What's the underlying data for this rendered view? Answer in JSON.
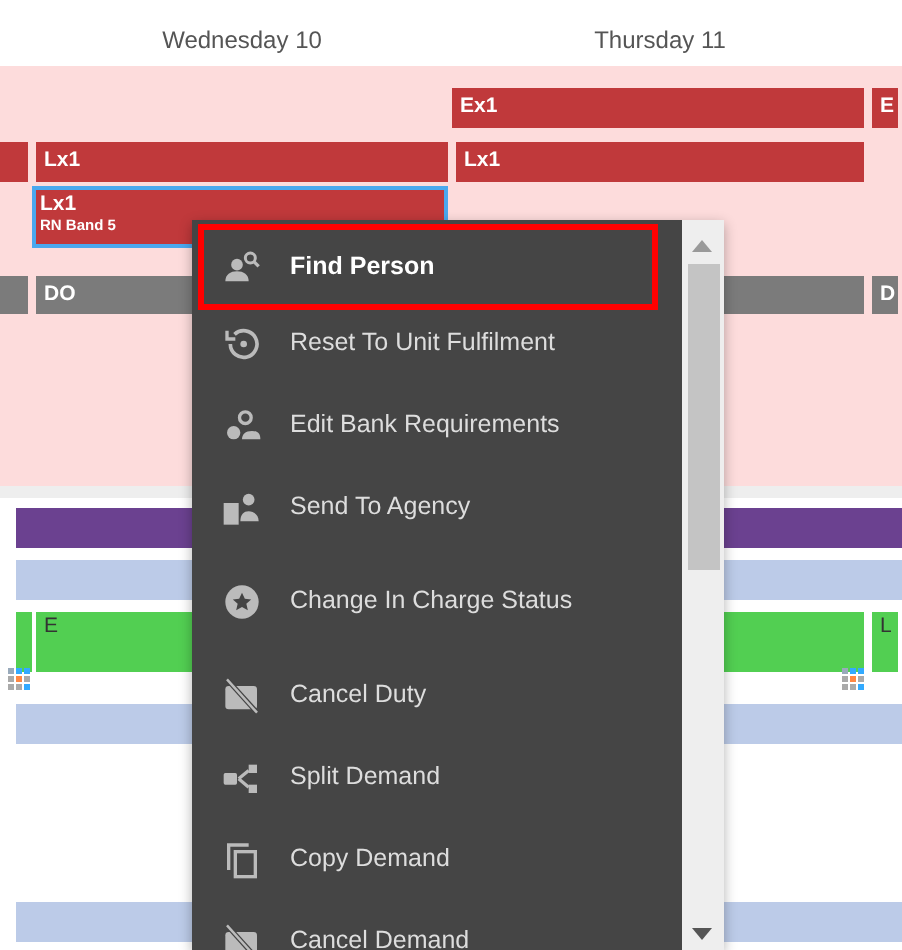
{
  "day_headers": [
    "Wednesday 10",
    "Thursday 11"
  ],
  "upper_lanes": [
    {
      "kind": "short",
      "cells": [
        {
          "kind": "empty"
        },
        {
          "kind": "empty"
        },
        {
          "kind": "bar",
          "label": "Ex1",
          "color": "#c0393b",
          "selected": false
        },
        {
          "kind": "bar",
          "label": "E",
          "color": "#c0393b",
          "selected": false
        }
      ]
    },
    {
      "kind": "short",
      "cells": [
        {
          "kind": "bar",
          "color": "#c0393b",
          "selected": false
        },
        {
          "kind": "bar",
          "label": "Lx1",
          "color": "#c0393b",
          "selected": false
        },
        {
          "kind": "bar",
          "label": "Lx1",
          "color": "#c0393b",
          "selected": false
        },
        {
          "kind": "empty"
        }
      ]
    },
    {
      "kind": "tall",
      "cells": [
        {
          "kind": "empty"
        },
        {
          "kind": "bar",
          "label": "Lx1",
          "sublabel": "RN Band 5",
          "color": "#c0393b",
          "selected": true
        },
        {
          "kind": "empty"
        },
        {
          "kind": "empty"
        }
      ]
    },
    {
      "kind": "off",
      "cells": [
        {
          "kind": "bar",
          "color": "#7b7b7b",
          "selected": false
        },
        {
          "kind": "bar",
          "label": "DO",
          "color": "#7b7b7b",
          "selected": false
        },
        {
          "kind": "bar",
          "color": "#7b7b7b",
          "selected": false
        },
        {
          "kind": "bar",
          "label": "D",
          "color": "#7b7b7b",
          "selected": false
        }
      ]
    }
  ],
  "lower_lanes": [
    {
      "kind": "band",
      "color": "#6b4190"
    },
    {
      "kind": "band",
      "color": "#bccbe8"
    },
    {
      "kind": "green",
      "cells": [
        {
          "kind": "marked",
          "color": "#52cf52",
          "selected": false
        },
        {
          "kind": "bar",
          "label": "E",
          "color": "#52cf52",
          "selected": false
        },
        {
          "kind": "marked",
          "color": "#52cf52",
          "selected": false
        },
        {
          "kind": "bar",
          "label": "L",
          "color": "#52cf52",
          "selected": false
        }
      ]
    },
    {
      "kind": "band",
      "color": "#bccbe8"
    },
    {
      "kind": "spacer"
    },
    {
      "kind": "band",
      "color": "#bccbe8"
    }
  ],
  "context_menu": {
    "items": [
      {
        "label": "Find Person",
        "kind": "find",
        "selected": true
      },
      {
        "label": "Reset To Unit Fulfilment",
        "kind": "reset",
        "selected": false
      },
      {
        "label": "Edit Bank Requirements",
        "kind": "people",
        "selected": false
      },
      {
        "label": "Send To Agency",
        "kind": "agency",
        "selected": false
      },
      {
        "label": "Change In Charge Status",
        "kind": "star",
        "selected": false
      },
      {
        "label": "Cancel Duty",
        "kind": "cancel",
        "selected": false
      },
      {
        "label": "Split Demand",
        "kind": "split",
        "selected": false
      },
      {
        "label": "Copy Demand",
        "kind": "copy",
        "selected": false
      },
      {
        "label": "Cancel Demand",
        "kind": "cancel",
        "selected": false
      }
    ]
  }
}
